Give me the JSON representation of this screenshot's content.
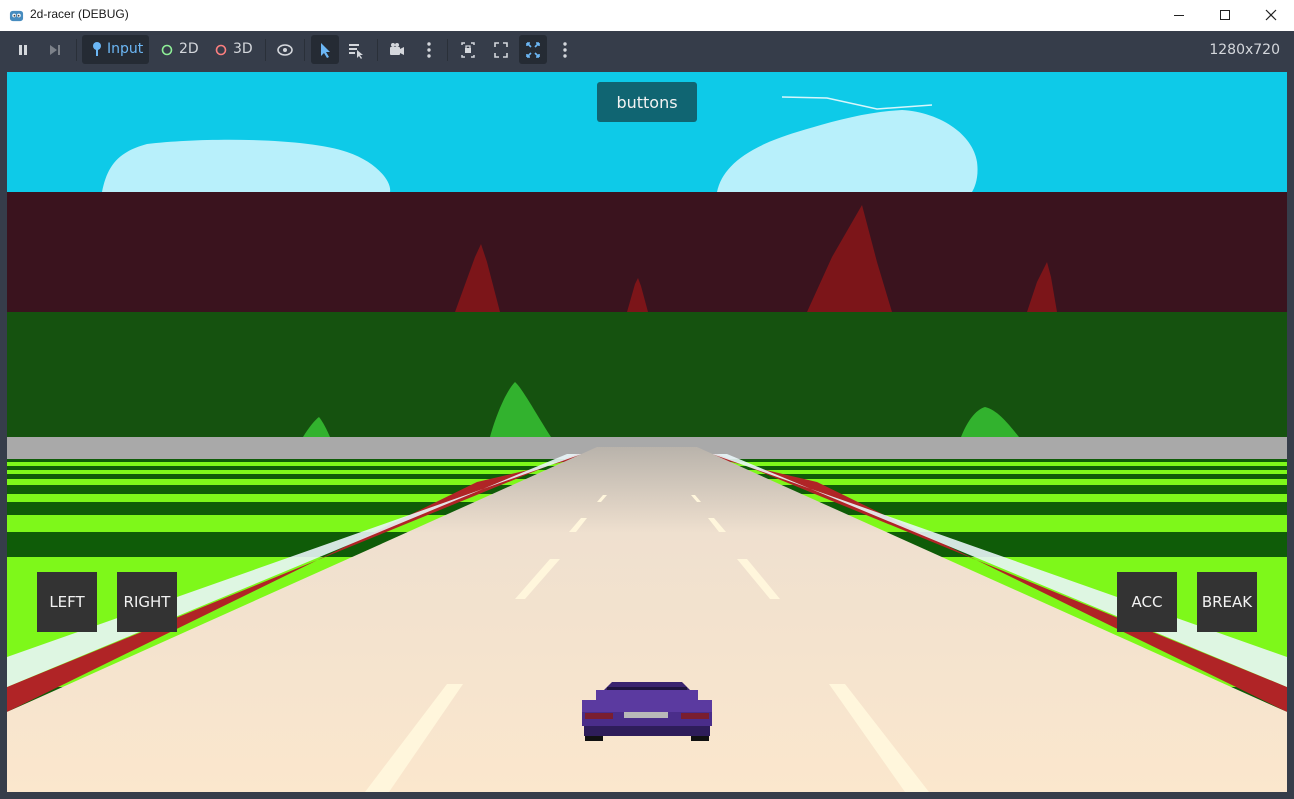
{
  "window": {
    "title": "2d-racer (DEBUG)"
  },
  "toolbar": {
    "input_label": "Input",
    "mode_2d_label": "2D",
    "mode_3d_label": "3D",
    "resolution": "1280x720"
  },
  "game": {
    "top_button": "buttons",
    "left_button": "LEFT",
    "right_button": "RIGHT",
    "acc_button": "ACC",
    "break_button": "BREAK"
  },
  "colors": {
    "sky": "#0ecae8",
    "cloud": "#b8f0fb",
    "mountain_band": "#3a131e",
    "mountain_peak": "#7c1519",
    "hill_band": "#15520f",
    "hill_peak": "#32b22e",
    "road": "#fbe7cd",
    "rumble_red": "#b02426",
    "rumble_white": "#e9f5f8",
    "grass_light": "#7ef81a",
    "grass_dark": "#0f5c08",
    "car": "#5b3aa0"
  }
}
